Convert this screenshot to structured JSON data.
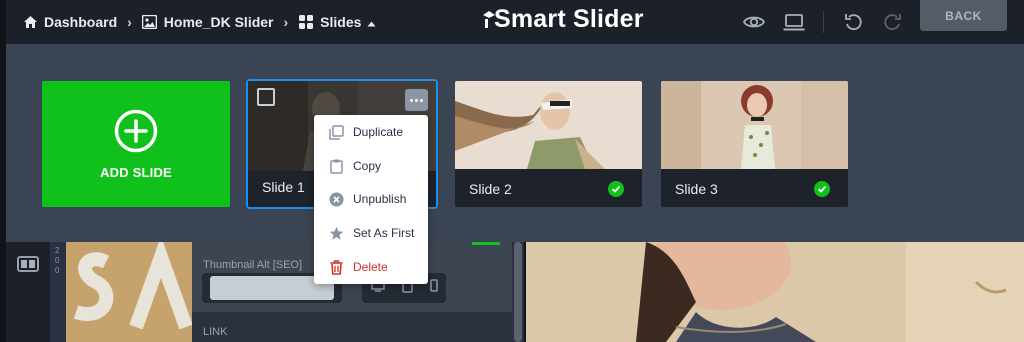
{
  "breadcrumb": {
    "dashboard_label": "Dashboard",
    "project_label": "Home_DK Slider",
    "slides_label": "Slides"
  },
  "logo_text": "Smart Slider",
  "toolbar": {
    "preview_icon": "eye-icon",
    "device_icon": "laptop-icon",
    "undo_icon": "undo-icon",
    "redo_icon": "redo-icon",
    "back_label": "BACK"
  },
  "slides": {
    "add_label": "ADD SLIDE",
    "items": [
      {
        "label": "Slide 1",
        "published": false,
        "selected": true
      },
      {
        "label": "Slide 2",
        "published": true
      },
      {
        "label": "Slide 3",
        "published": true
      }
    ]
  },
  "context_menu": {
    "items": [
      {
        "label": "Duplicate",
        "icon": "duplicate-icon"
      },
      {
        "label": "Copy",
        "icon": "clipboard-icon"
      },
      {
        "label": "Unpublish",
        "icon": "unpublish-icon"
      },
      {
        "label": "Set As First",
        "icon": "star-icon"
      },
      {
        "label": "Delete",
        "icon": "trash-icon"
      }
    ]
  },
  "side_panel": {
    "thumbnail_alt_label": "Thumbnail Alt [SEO]",
    "thumbnail_alt_value": "",
    "link_section_label": "LINK"
  },
  "ruler_labels": [
    "2",
    "0",
    "0"
  ],
  "colors": {
    "accent_green": "#11c11b",
    "selection_blue": "#1f8eea",
    "delete_red": "#d1352a"
  }
}
